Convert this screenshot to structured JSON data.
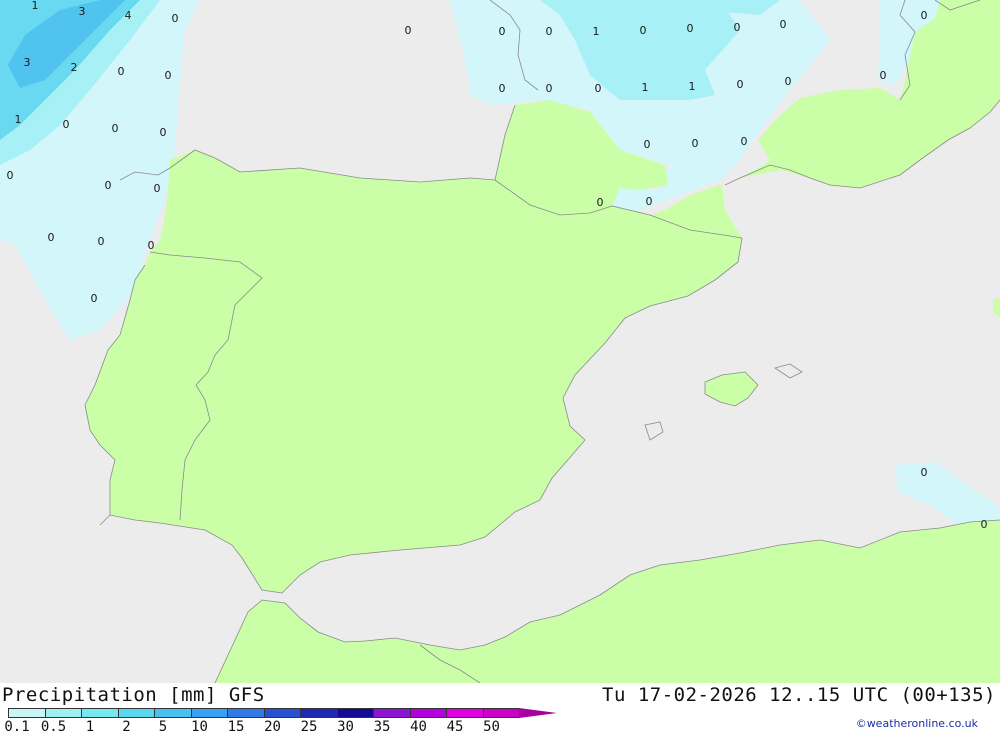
{
  "header": {
    "title": "Precipitation [mm] GFS",
    "datetime": "Tu 17-02-2026 12..15 UTC (00+135)"
  },
  "legend": {
    "labels": [
      "0.1",
      "0.5",
      "1",
      "2",
      "5",
      "10",
      "15",
      "20",
      "25",
      "30",
      "35",
      "40",
      "45",
      "50"
    ],
    "colors": [
      "#c8f6f6",
      "#a0f0f0",
      "#78e8f0",
      "#5ad8f0",
      "#48c0f0",
      "#3ca0f0",
      "#3278e6",
      "#2850d2",
      "#1e28b4",
      "#140a96",
      "#8c14d2",
      "#b400dc",
      "#e100e1",
      "#c800c8"
    ],
    "arrow_color": "#a7009f"
  },
  "map": {
    "colors": {
      "sea": "#ececec",
      "land": "#caffa8",
      "coast": "#8a8a8a",
      "precip_light": "#d2f6fa",
      "precip_medium": "#a6f0f6",
      "precip_heavy": "#68d9f0",
      "precip_core": "#50c4ee"
    },
    "values": [
      {
        "label": "1"
      },
      {
        "label": "3"
      },
      {
        "label": "4"
      },
      {
        "label": "0"
      },
      {
        "label": "3"
      },
      {
        "label": "2"
      },
      {
        "label": "0"
      },
      {
        "label": "0"
      },
      {
        "label": "1"
      },
      {
        "label": "0"
      },
      {
        "label": "0"
      },
      {
        "label": "0"
      },
      {
        "label": "0"
      },
      {
        "label": "0"
      },
      {
        "label": "0"
      },
      {
        "label": "0"
      },
      {
        "label": "0"
      },
      {
        "label": "0"
      },
      {
        "label": "0"
      },
      {
        "label": "0"
      },
      {
        "label": "1"
      },
      {
        "label": "0"
      },
      {
        "label": "0"
      },
      {
        "label": "0"
      },
      {
        "label": "0"
      },
      {
        "label": "0"
      },
      {
        "label": "0"
      },
      {
        "label": "0"
      },
      {
        "label": "1"
      },
      {
        "label": "1"
      },
      {
        "label": "0"
      },
      {
        "label": "0"
      },
      {
        "label": "0"
      },
      {
        "label": "0"
      },
      {
        "label": "0"
      },
      {
        "label": "0"
      },
      {
        "label": "0"
      },
      {
        "label": "0"
      },
      {
        "label": "0"
      },
      {
        "label": "0"
      },
      {
        "label": "0"
      }
    ]
  },
  "credit": "©weatheronline.co.uk"
}
